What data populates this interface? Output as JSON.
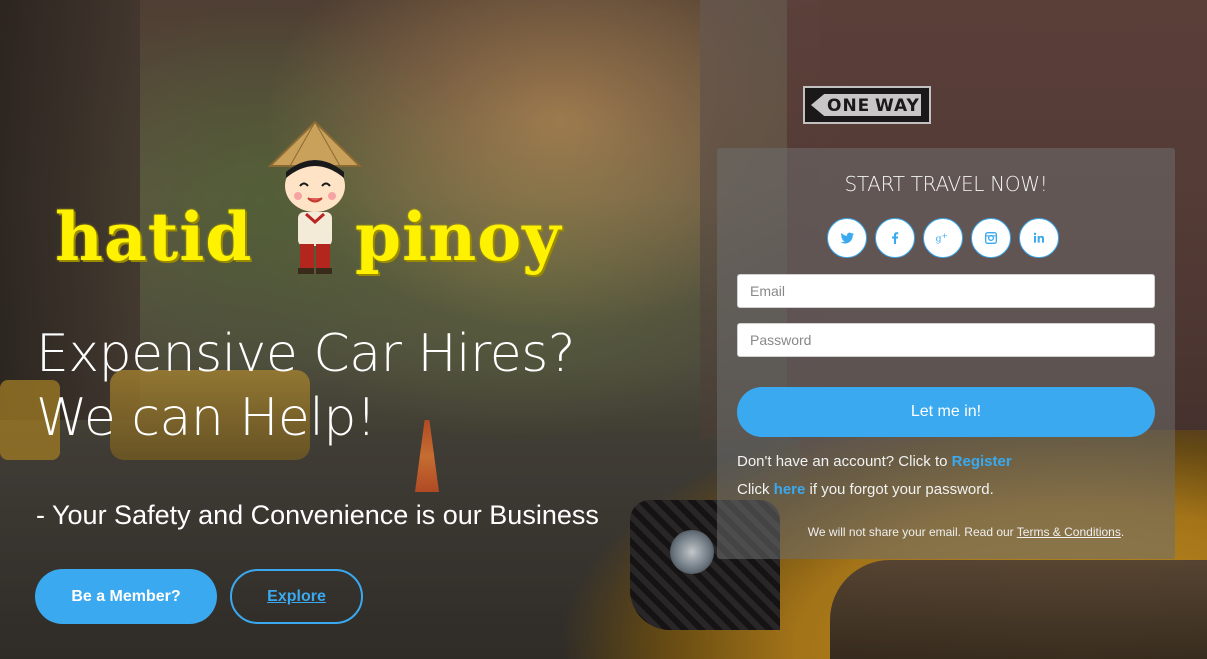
{
  "logo": {
    "word1": "hatid",
    "word2": "pinoy"
  },
  "hero": {
    "headline_line1": "Expensive Car Hires?",
    "headline_line2": "We can Help!",
    "tagline": "- Your Safety and Convenience is our Business",
    "member_button": "Be a Member?",
    "explore_button": "Explore"
  },
  "background": {
    "sign_left": "ONE",
    "sign_right": "WAY"
  },
  "login": {
    "title": "START TRAVEL NOW!",
    "socials": [
      "twitter-icon",
      "facebook-icon",
      "google-plus-icon",
      "instagram-icon",
      "linkedin-icon"
    ],
    "email_placeholder": "Email",
    "password_placeholder": "Password",
    "submit_label": "Let me in!",
    "register_prefix": "Don't have an account? Click to ",
    "register_link": "Register",
    "forgot_prefix": "Click ",
    "forgot_link": "here",
    "forgot_suffix": " if you forgot your password.",
    "note_prefix": "We will not share your email. Read our ",
    "note_link": "Terms & Conditions",
    "note_suffix": "."
  },
  "colors": {
    "accent": "#3aa9ef",
    "logo_yellow": "#fff200"
  }
}
